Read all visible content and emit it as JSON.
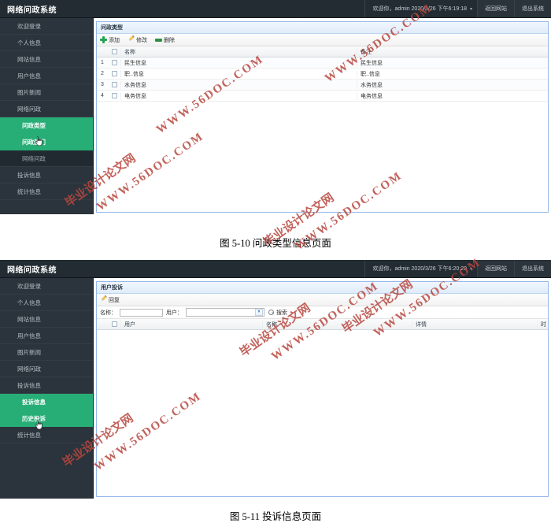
{
  "document": {
    "captions": [
      {
        "text": "图 5-10 问政类型信息页面"
      },
      {
        "text": "图 5-11 投诉信息页面"
      }
    ],
    "watermarks": [
      {
        "line1": "毕业设计论文网",
        "line2": "WWW.56DOC.COM"
      }
    ]
  },
  "screens": [
    {
      "id": "screen-govtype",
      "brand": "网络问政系统",
      "topbar": {
        "welcome": "欢迎你，admin  2020/3/26 下午6:19:18",
        "caret": "▾",
        "back_to_site": "返回网站",
        "logout": "退出系统"
      },
      "sidebar": {
        "items": [
          {
            "label": "欢迎登录",
            "state": "normal"
          },
          {
            "label": "个人信息",
            "state": "normal"
          },
          {
            "label": "网站信息",
            "state": "normal"
          },
          {
            "label": "用户信息",
            "state": "normal"
          },
          {
            "label": "图片新闻",
            "state": "normal"
          },
          {
            "label": "网络问政",
            "state": "normal"
          },
          {
            "label": "问政类型",
            "state": "active-sub"
          },
          {
            "label": "问政部门",
            "state": "active-sub"
          },
          {
            "label": "网络问政",
            "state": "dark-sub"
          },
          {
            "label": "投诉信息",
            "state": "normal"
          },
          {
            "label": "统计信息",
            "state": "normal"
          }
        ]
      },
      "panel": {
        "title": "问政类型",
        "toolbar": [
          {
            "label": "添加",
            "icon": "plus-icon"
          },
          {
            "label": "修改",
            "icon": "pencil-icon"
          },
          {
            "label": "删除",
            "icon": "minus-icon"
          }
        ],
        "table": {
          "columns": [
            "名称",
            "备注"
          ],
          "rows": [
            {
              "index": "1",
              "name": "民生信息",
              "remark": "民生信息"
            },
            {
              "index": "2",
              "name": "职..信息",
              "remark": "职..信息"
            },
            {
              "index": "3",
              "name": "水务信息",
              "remark": "水务信息"
            },
            {
              "index": "4",
              "name": "电务信息",
              "remark": "电务信息"
            }
          ]
        }
      }
    },
    {
      "id": "screen-complaint",
      "brand": "网络问政系统",
      "topbar": {
        "welcome": "欢迎你，admin  2020/3/26 下午6:20:29",
        "caret": "▾",
        "back_to_site": "返回网站",
        "logout": "退出系统"
      },
      "sidebar": {
        "items": [
          {
            "label": "欢迎登录",
            "state": "normal"
          },
          {
            "label": "个人信息",
            "state": "normal"
          },
          {
            "label": "网站信息",
            "state": "normal"
          },
          {
            "label": "用户信息",
            "state": "normal"
          },
          {
            "label": "图片新闻",
            "state": "normal"
          },
          {
            "label": "网络问政",
            "state": "normal"
          },
          {
            "label": "投诉信息",
            "state": "normal"
          },
          {
            "label": "投诉信息",
            "state": "active-sub"
          },
          {
            "label": "历史投诉",
            "state": "active-sub"
          },
          {
            "label": "统计信息",
            "state": "normal"
          }
        ]
      },
      "panel": {
        "title": "用户投诉",
        "toolbar": [
          {
            "label": "回复",
            "icon": "pencil-icon"
          }
        ],
        "filters": {
          "name_label": "名称：",
          "name_value": "",
          "name_placeholder": "",
          "user_label": "用户：",
          "user_value": "",
          "search_label": "搜索"
        },
        "table": {
          "columns": [
            "用户",
            "名称",
            "详情",
            "时"
          ],
          "rows": []
        }
      }
    }
  ]
}
